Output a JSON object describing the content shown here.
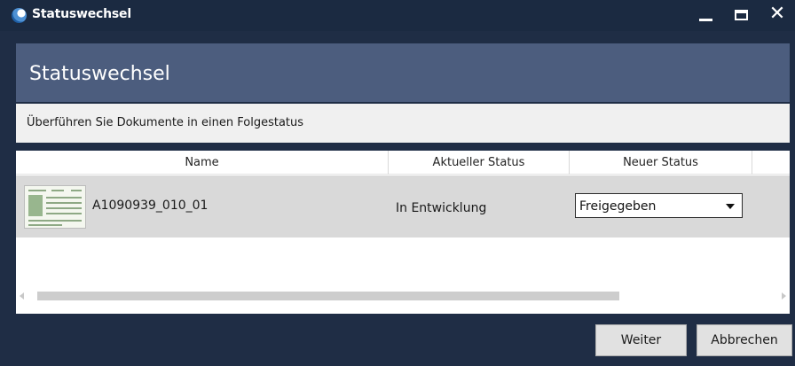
{
  "window": {
    "title": "Statuswechsel",
    "controls": {
      "minimize": "minimize-icon",
      "maximize": "maximize-icon",
      "close": "close-icon",
      "close_glyph": "✕"
    }
  },
  "header": {
    "title": "Statuswechsel"
  },
  "subheader": {
    "text": "Überführen Sie Dokumente in einen Folgestatus"
  },
  "grid": {
    "columns": [
      "Name",
      "Aktueller Status",
      "Neuer Status"
    ],
    "rows": [
      {
        "name": "A1090939_010_01",
        "current_status": "In Entwicklung",
        "new_status": "Freigegeben",
        "thumbnail": "document-thumbnail"
      }
    ]
  },
  "footer": {
    "next_label": "Weiter",
    "cancel_label": "Abbrechen"
  },
  "colors": {
    "titlebar": "#1b2a41",
    "window_bg": "#1f2d45",
    "header_bg": "#4c5d7e",
    "row_selected": "#d9d9d9"
  }
}
